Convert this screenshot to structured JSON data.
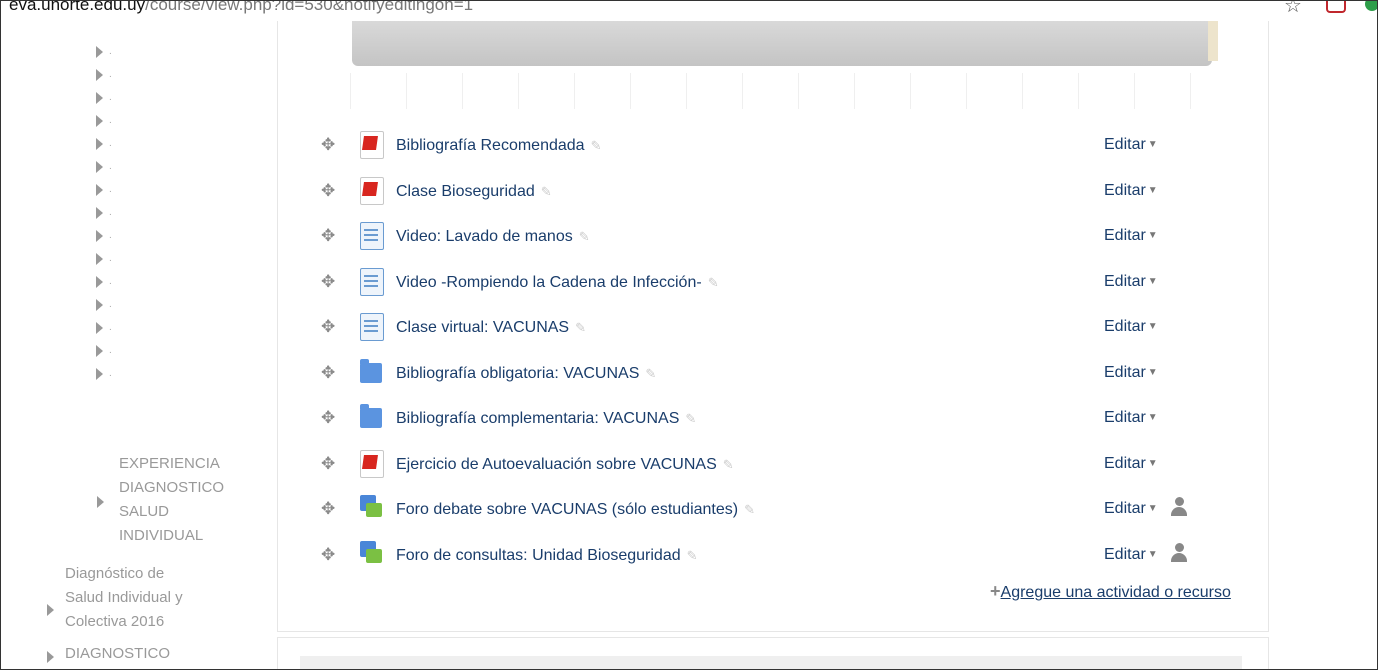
{
  "browser": {
    "url_host": "eva.unorte.edu.uy",
    "url_path": "/course/view.php?id=530&notifyeditingon=1",
    "star_icon": "star-icon"
  },
  "sidebar": {
    "placeholder_dot": ".",
    "collapsed_items_count": 15,
    "labels": [
      {
        "lines": [
          "EXPERIENCIA",
          "DIAGNOSTICO",
          "SALUD",
          "INDIVIDUAL"
        ]
      },
      {
        "lines": [
          "Diagnóstico de",
          "Salud Individual y",
          "Colectiva 2016"
        ]
      },
      {
        "lines": [
          "DIAGNOSTICO"
        ]
      }
    ]
  },
  "activities": [
    {
      "icon": "pdf-icon",
      "name": "Bibliografía Recomendada",
      "edit": "Editar",
      "user": false
    },
    {
      "icon": "pdf-icon",
      "name": "Clase Bioseguridad",
      "edit": "Editar",
      "user": false
    },
    {
      "icon": "page-icon",
      "name": "Video: Lavado de manos",
      "edit": "Editar",
      "user": false
    },
    {
      "icon": "page-icon",
      "name": "Video -Rompiendo la Cadena de Infección-",
      "edit": "Editar",
      "user": false
    },
    {
      "icon": "page-icon",
      "name": "Clase virtual: VACUNAS",
      "edit": "Editar",
      "user": false
    },
    {
      "icon": "folder-icon",
      "name": "Bibliografía obligatoria: VACUNAS",
      "edit": "Editar",
      "user": false
    },
    {
      "icon": "folder-icon",
      "name": "Bibliografía complementaria: VACUNAS",
      "edit": "Editar",
      "user": false
    },
    {
      "icon": "pdf-icon",
      "name": "Ejercicio de Autoevaluación sobre VACUNAS",
      "edit": "Editar",
      "user": false
    },
    {
      "icon": "forum-icon",
      "name": "Foro debate sobre VACUNAS (sólo estudiantes)",
      "edit": "Editar",
      "user": true
    },
    {
      "icon": "forum-icon",
      "name": "Foro de consultas: Unidad Bioseguridad",
      "edit": "Editar",
      "user": true
    }
  ],
  "add_activity": {
    "plus": "+",
    "label": "Agregue una actividad o recurso"
  }
}
